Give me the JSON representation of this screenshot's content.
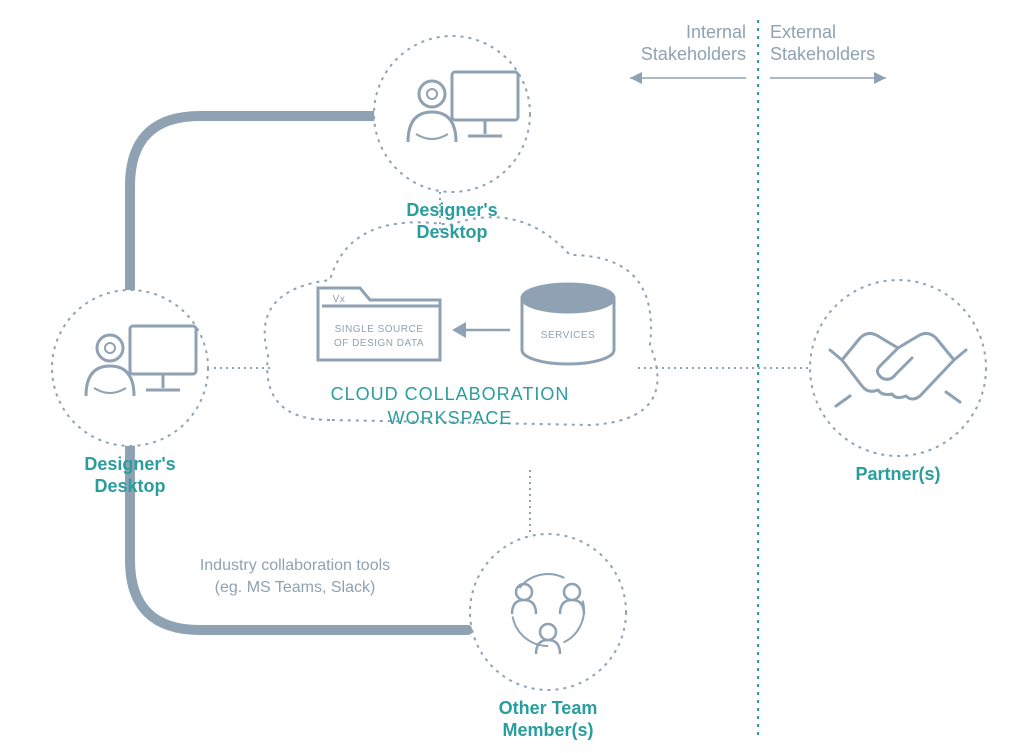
{
  "sections": {
    "internal_l1": "Internal",
    "internal_l2": "Stakeholders",
    "external_l1": "External",
    "external_l2": "Stakeholders"
  },
  "nodes": {
    "designer_top": {
      "line1": "Designer's",
      "line2": "Desktop"
    },
    "designer_left": {
      "line1": "Designer's",
      "line2": "Desktop"
    },
    "team": {
      "line1": "Other Team",
      "line2": "Member(s)"
    },
    "partners": {
      "line1": "Partner(s)"
    }
  },
  "cloud": {
    "title_l1": "CLOUD COLLABORATION",
    "title_l2": "WORKSPACE",
    "folder_tag": "Vx",
    "folder_l1": "SINGLE SOURCE",
    "folder_l2": "OF DESIGN DATA",
    "services": "SERVICES"
  },
  "connector": {
    "label_l1": "Industry collaboration tools",
    "label_l2": "(eg. MS Teams, Slack)"
  }
}
